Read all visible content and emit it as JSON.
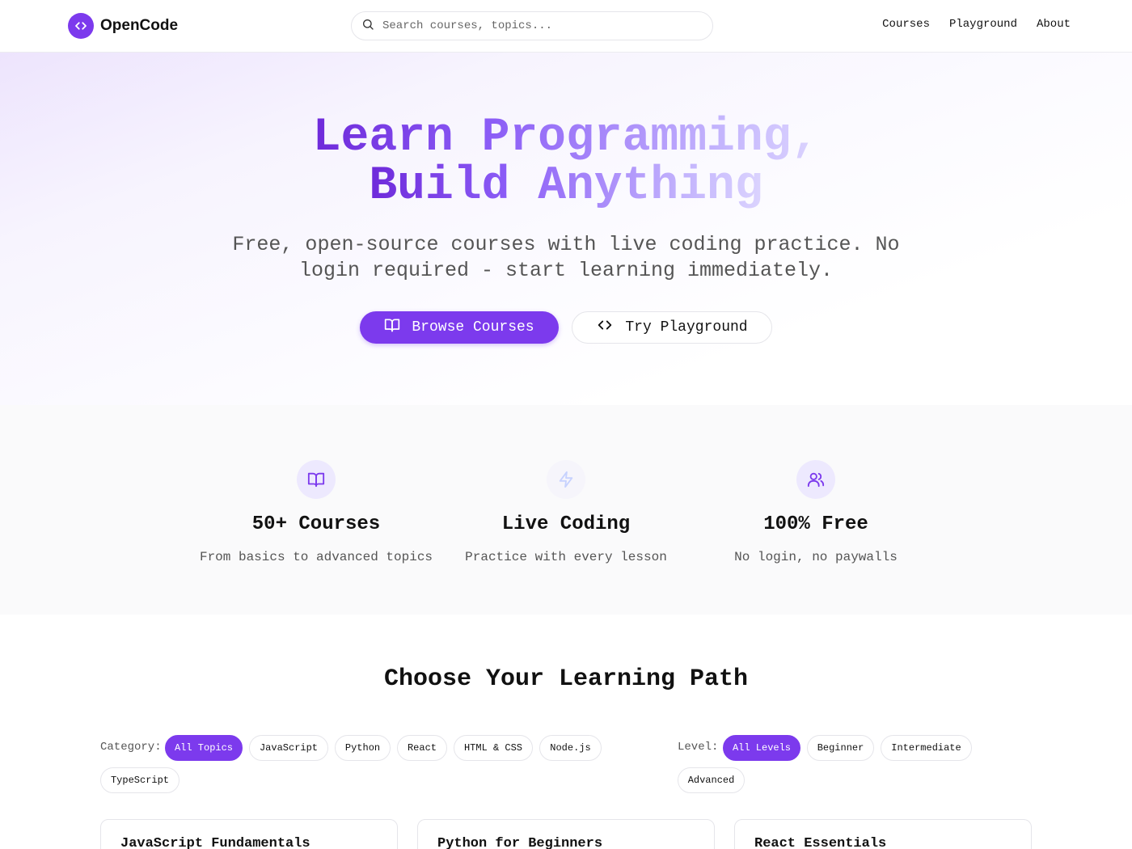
{
  "header": {
    "brand": "OpenCode",
    "search_placeholder": "Search courses, topics...",
    "nav": [
      "Courses",
      "Playground",
      "About"
    ]
  },
  "hero": {
    "title_line1": "Learn Programming,",
    "title_line2": "Build Anything",
    "subtitle": "Free, open-source courses with live coding practice. No login required - start learning immediately.",
    "primary_button": "Browse Courses",
    "secondary_button": "Try Playground"
  },
  "features": [
    {
      "icon": "book-open-icon",
      "title": "50+ Courses",
      "desc": "From basics to advanced topics"
    },
    {
      "icon": "zap-icon",
      "title": "Live Coding",
      "desc": "Practice with every lesson"
    },
    {
      "icon": "users-icon",
      "title": "100% Free",
      "desc": "No login, no paywalls"
    }
  ],
  "learning_path": {
    "title": "Choose Your Learning Path",
    "category_label": "Category:",
    "categories": [
      "All Topics",
      "JavaScript",
      "Python",
      "React",
      "HTML & CSS",
      "Node.js",
      "TypeScript"
    ],
    "selected_category": "All Topics",
    "level_label": "Level:",
    "levels": [
      "All Levels",
      "Beginner",
      "Intermediate",
      "Advanced"
    ],
    "selected_level": "All Levels"
  },
  "courses": [
    {
      "title": "JavaScript Fundamentals"
    },
    {
      "title": "Python for Beginners"
    },
    {
      "title": "React Essentials"
    }
  ],
  "colors": {
    "accent": "#7c3aed",
    "accent_light": "#ede9fe",
    "text_muted": "#555555"
  }
}
